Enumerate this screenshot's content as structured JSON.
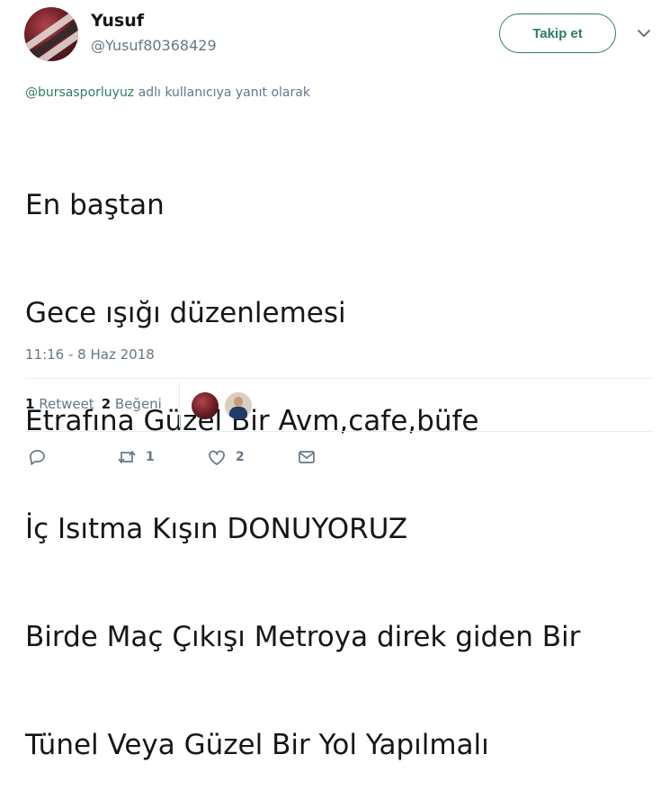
{
  "user": {
    "fullname": "Yusuf",
    "screen_name": "@Yusuf80368429"
  },
  "follow_button": {
    "label": "Takip et"
  },
  "reply_context": {
    "mention": "@bursasporluyuz",
    "suffix": " adlı kullanıcıya yanıt olarak"
  },
  "tweet": {
    "lines": [
      "En baştan",
      "Gece ışığı düzenlemesi",
      "Etrafına Güzel Bir Avm,cafe,büfe",
      "İç Isıtma Kışın DONUYORUZ",
      "Birde Maç Çıkışı Metroya direk giden Bir",
      "Tünel Veya Güzel Bir Yol Yapılmalı"
    ],
    "timestamp": "11:16 - 8 Haz 2018"
  },
  "stats": {
    "retweet_count": "1",
    "retweet_label": "Retweet",
    "like_count": "2",
    "like_label": "Beğeni"
  },
  "actions": {
    "retweet_count": "1",
    "like_count": "2"
  },
  "colors": {
    "accent": "#2e7d5b",
    "secondary_text": "#657786",
    "primary_text": "#14171a"
  }
}
